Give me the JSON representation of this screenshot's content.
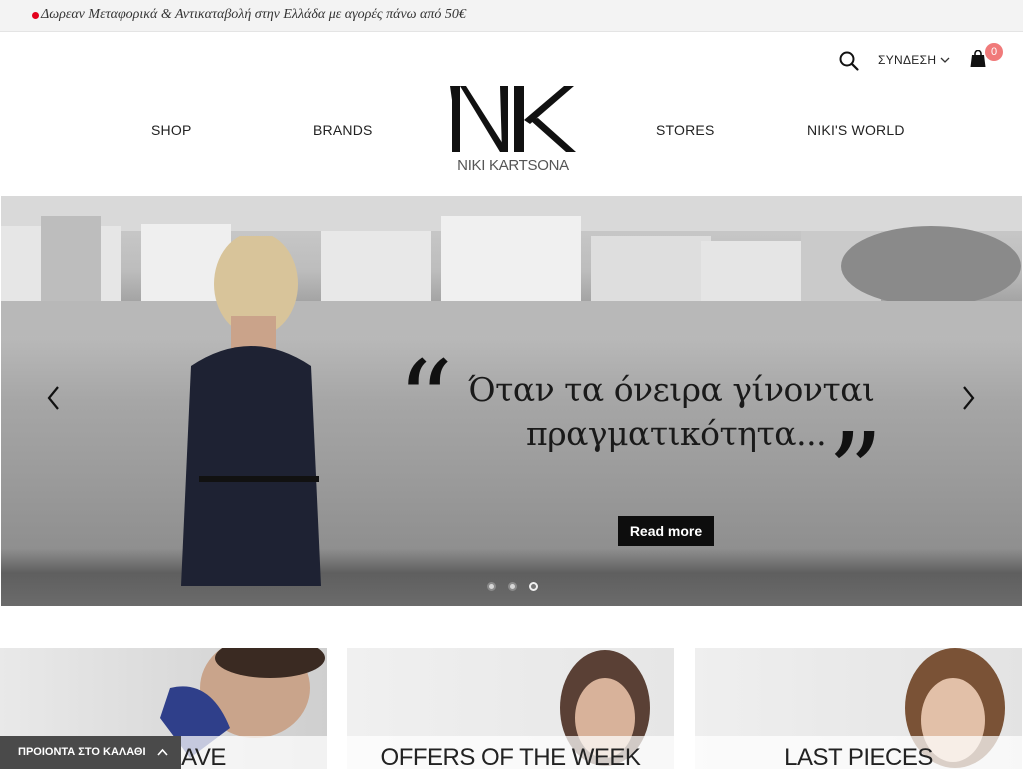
{
  "topbar": {
    "promo": "Δωρεαν Μεταφορικά & Αντικαταβολή στην Ελλάδα με αγορές πάνω από 50€"
  },
  "header": {
    "login_label": "ΣΥΝΔΕΣΗ",
    "cart_count": "0",
    "logo_text": "NIKI KARTSONA",
    "nav": {
      "shop": "SHOP",
      "brands": "BRANDS",
      "stores": "STORES",
      "world": "NIKI'S WORLD"
    }
  },
  "hero": {
    "quote_line1": "Όταν τα όνειρα γίνονται",
    "quote_line2": "πραγματικότητα...",
    "open_mark": "“",
    "close_mark": "”",
    "cta": "Read more",
    "slides": 3,
    "active_slide": 3
  },
  "cards": [
    {
      "title": "AVE"
    },
    {
      "title": "OFFERS OF THE WEEK"
    },
    {
      "title": "LAST PIECES"
    }
  ],
  "cart_bar": {
    "label": "ΠΡΟΙΟΝΤΑ ΣΤΟ ΚΑΛΑΘΙ"
  },
  "colors": {
    "badge": "#f07a7a",
    "promo_dot": "#e3001b",
    "button": "#0d0d0d"
  }
}
